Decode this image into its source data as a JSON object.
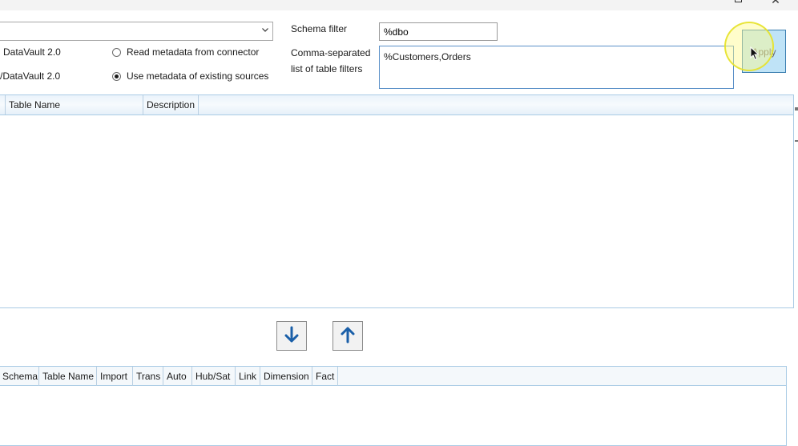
{
  "window": {
    "close_glyph": "✕"
  },
  "source": {
    "combo_value": "",
    "option_1_label": "DataVault 2.0",
    "option_2_label": "/DataVault 2.0",
    "chevron_icon": "chevron-down-icon"
  },
  "metadata_mode": {
    "options": [
      {
        "label": "Read metadata from connector",
        "checked": false
      },
      {
        "label": "Use metadata of existing sources",
        "checked": true
      }
    ]
  },
  "filters": {
    "schema_label": "Schema filter",
    "schema_value": "%dbo",
    "table_label_line1": "Comma-separated",
    "table_label_line2": "list of table filters",
    "table_value": "%Customers,Orders"
  },
  "apply_button": {
    "label": "Apply"
  },
  "upper_grid": {
    "columns": [
      "Table Name",
      "Description"
    ]
  },
  "lower_grid": {
    "columns": [
      "Schema",
      "Table Name",
      "Import",
      "Trans",
      "Auto",
      "Hub/Sat",
      "Link",
      "Dimension",
      "Fact"
    ]
  },
  "arrows": {
    "down_icon": "arrow-down-icon",
    "up_icon": "arrow-up-icon"
  },
  "colors": {
    "accent_blue": "#1a5fa8",
    "apply_bg": "#bfe3f7",
    "grid_border": "#aacbe5",
    "highlight_yellow": "#fffa8c"
  }
}
